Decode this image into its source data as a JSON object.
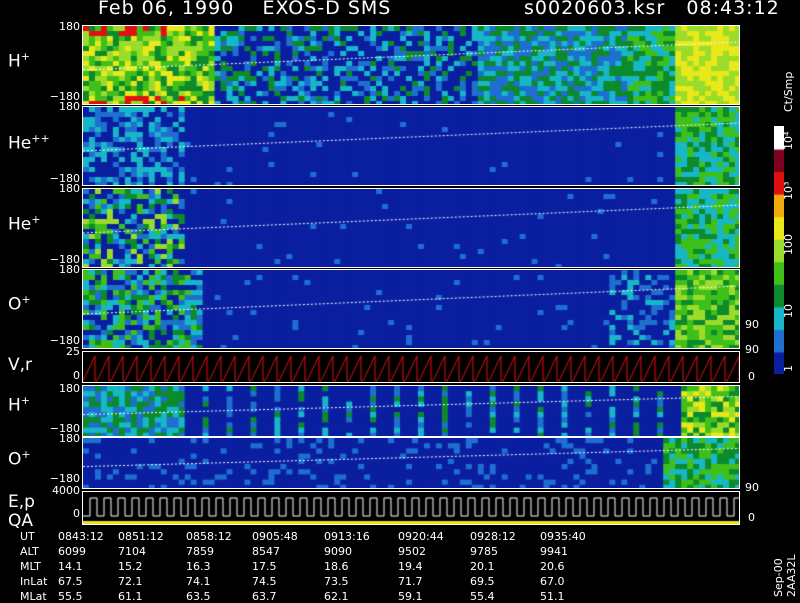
{
  "header": {
    "date": "Feb 06, 1990",
    "instrument": "EXOS-D SMS",
    "file": "s0020603.ksr",
    "time": "08:43:12"
  },
  "panels": [
    {
      "id": "h-plus-1",
      "species": "H",
      "charge": "+",
      "ytop": "180",
      "ybot": "−180"
    },
    {
      "id": "he-pp",
      "species": "He",
      "charge": "++",
      "ytop": "180",
      "ybot": "−180"
    },
    {
      "id": "he-plus",
      "species": "He",
      "charge": "+",
      "ytop": "180",
      "ybot": "−180"
    },
    {
      "id": "o-plus-1",
      "species": "O",
      "charge": "+",
      "ytop": "180",
      "ybot": "−180",
      "rtop": "90"
    },
    {
      "id": "vr",
      "label": "V,r",
      "ytop": "25",
      "ybot": "0",
      "rtop": "90",
      "rbot": "0"
    },
    {
      "id": "h-plus-2",
      "species": "H",
      "charge": "+",
      "ytop": "180",
      "ybot": "−180"
    },
    {
      "id": "o-plus-2",
      "species": "O",
      "charge": "+",
      "ytop": "180",
      "ybot": "−180",
      "rtop": "90"
    },
    {
      "id": "ep",
      "label1": "E,p",
      "label2": "QA",
      "ytop": "4000",
      "ybot": "0",
      "rbot": "0"
    }
  ],
  "colorbar": {
    "unit": "Ct/Smp",
    "ticks": [
      "1",
      "10",
      "100",
      "10³",
      "10⁴"
    ],
    "colors": [
      "#0a1fa0",
      "#1e6fd0",
      "#17b7c9",
      "#0c8a2c",
      "#3fbf1a",
      "#9bdc2a",
      "#e8e81a",
      "#f2a90f",
      "#e01010",
      "#800020",
      "#ffffff"
    ]
  },
  "footer": {
    "rows": [
      {
        "label": "UT",
        "values": [
          "0843:12",
          "0851:12",
          "0858:12",
          "0905:48",
          "0913:16",
          "0920:44",
          "0928:12",
          "0935:40"
        ]
      },
      {
        "label": "ALT",
        "values": [
          "6099",
          "7104",
          "7859",
          "8547",
          "9090",
          "9502",
          "9785",
          "9941"
        ]
      },
      {
        "label": "MLT",
        "values": [
          "14.1",
          "15.2",
          "16.3",
          "17.5",
          "18.6",
          "19.4",
          "20.1",
          "20.6"
        ]
      },
      {
        "label": "InLat",
        "values": [
          "67.5",
          "72.1",
          "74.1",
          "74.5",
          "73.5",
          "71.7",
          "69.5",
          "67.0"
        ]
      },
      {
        "label": "MLat",
        "values": [
          "55.5",
          "61.1",
          "63.5",
          "63.7",
          "62.1",
          "59.1",
          "55.4",
          "51.1"
        ]
      }
    ],
    "side_note": "Sep-00  2AA32L"
  },
  "chart_data": {
    "type": "heatmap",
    "title": "Feb 06, 1990   EXOS-D SMS   s0020603.ksr   08:43:12",
    "x_ticks_UT": [
      "0843:12",
      "0851:12",
      "0858:12",
      "0905:48",
      "0913:16",
      "0920:44",
      "0928:12",
      "0935:40"
    ],
    "pitch_angle_range": [
      -180,
      180
    ],
    "colorbar_unit": "Ct/Smp",
    "colorbar_log_range": [
      1,
      10000
    ],
    "series": [
      {
        "name": "H+",
        "ylim": [
          -180,
          180
        ]
      },
      {
        "name": "He++",
        "ylim": [
          -180,
          180
        ]
      },
      {
        "name": "He+",
        "ylim": [
          -180,
          180
        ]
      },
      {
        "name": "O+",
        "ylim": [
          -180,
          180
        ]
      },
      {
        "name": "V,r",
        "ylim": [
          0,
          25
        ],
        "right_axis": [
          0,
          90
        ]
      },
      {
        "name": "H+",
        "ylim": [
          -180,
          180
        ]
      },
      {
        "name": "O+",
        "ylim": [
          -180,
          180
        ]
      },
      {
        "name": "E,p / QA",
        "ylim": [
          0,
          4000
        ]
      }
    ]
  }
}
